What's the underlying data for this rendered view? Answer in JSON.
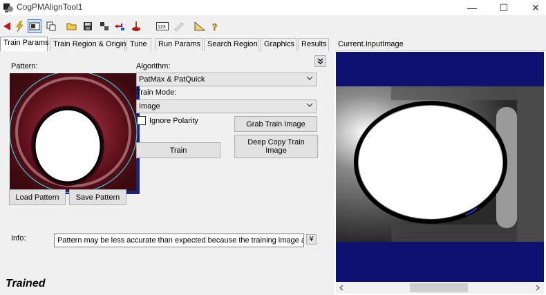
{
  "window": {
    "title": "CogPMAlignTool1",
    "minimize": "—",
    "maximize": "☐",
    "close": "✕"
  },
  "tabs": [
    "Train Params",
    "Train Region & Origin",
    "Tune",
    "Run Params",
    "Search Region",
    "Graphics",
    "Results"
  ],
  "train_params": {
    "pattern_label": "Pattern:",
    "algorithm_label": "Algorithm:",
    "algorithm_value": "PatMax & PatQuick",
    "train_mode_label": "Train Mode:",
    "train_mode_value": "Image",
    "ignore_polarity_label": "Ignore Polarity",
    "ignore_polarity_checked": false,
    "grab_train_image": "Grab Train Image",
    "train": "Train",
    "deep_copy_line1": "Deep Copy Train",
    "deep_copy_line2": "Image",
    "load_pattern": "Load Pattern",
    "save_pattern": "Save Pattern",
    "info_label": "Info:",
    "info_text": "Pattern may be less accurate than expected because the training image app",
    "collapse_glyph": "¥"
  },
  "status": "Trained",
  "image_panel": {
    "title": "Current.InputImage"
  },
  "icons": [
    "run-icon",
    "lightning-icon",
    "image-source-icon",
    "copy-icon",
    "open-folder-icon",
    "save-icon",
    "settings-icon",
    "reset-icon",
    "timing-icon",
    "numeric-icon",
    "edit-icon",
    "ruler-icon",
    "help-icon"
  ]
}
